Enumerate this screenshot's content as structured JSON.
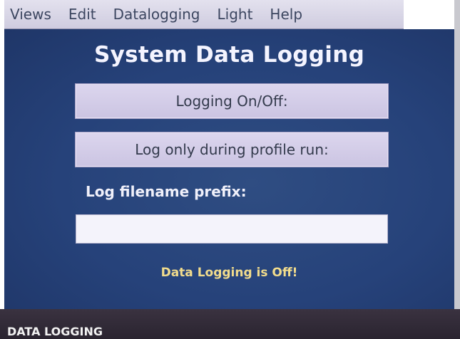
{
  "menu": {
    "items": [
      "Views",
      "Edit",
      "Datalogging",
      "Light",
      "Help"
    ]
  },
  "panel": {
    "title": "System Data Logging",
    "logging_button_label": "Logging On/Off:",
    "profile_button_label": "Log only during profile run:",
    "prefix_label": "Log filename prefix:",
    "prefix_value": "",
    "status_text": "Data Logging is Off!"
  },
  "footer": {
    "label": "DATA LOGGING"
  },
  "colors": {
    "panel_background": "#26427a",
    "status_text": "#f2dc8c",
    "button_background": "#d4cee8"
  }
}
